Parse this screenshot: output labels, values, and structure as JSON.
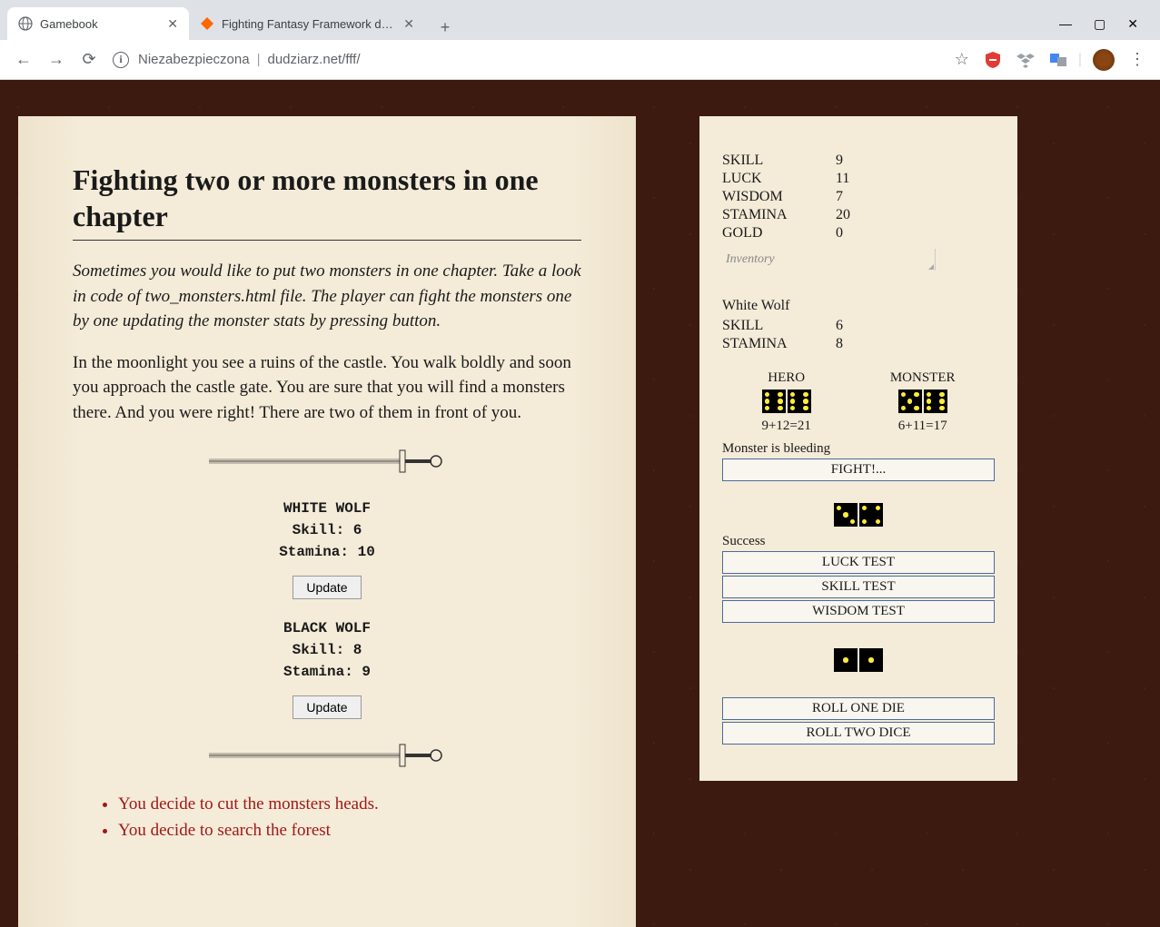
{
  "browser": {
    "tabs": [
      {
        "title": "Gamebook",
        "active": true
      },
      {
        "title": "Fighting Fantasy Framework dow...",
        "active": false
      }
    ],
    "window_controls": {
      "min": "—",
      "max": "▢",
      "close": "✕"
    },
    "address": {
      "security": "Niezabezpieczona",
      "url": "dudziarz.net/fff/"
    }
  },
  "page": {
    "title": "Fighting two or more monsters in one chapter",
    "intro": "Sometimes you would like to put two monsters in one chapter. Take a look in code of two_monsters.html file. The player can fight the monsters one by one updating the monster stats by pressing button.",
    "story": "In the moonlight you see a ruins of the castle. You walk boldly and soon you approach the castle gate. You are sure that you will find a monsters there. And you were right! There are two of them in front of you.",
    "monsters": [
      {
        "name": "WHITE WOLF",
        "skill_label": "Skill: 6",
        "stamina_label": "Stamina: 10",
        "button": "Update"
      },
      {
        "name": "BLACK WOLF",
        "skill_label": "Skill: 8",
        "stamina_label": "Stamina: 9",
        "button": "Update"
      }
    ],
    "choices": [
      "You decide to cut the monsters heads.",
      "You decide to search the forest"
    ]
  },
  "sidebar": {
    "hero_stats": {
      "skill": {
        "label": "SKILL",
        "value": "9"
      },
      "luck": {
        "label": "LUCK",
        "value": "11"
      },
      "wisdom": {
        "label": "WISDOM",
        "value": "7"
      },
      "stamina": {
        "label": "STAMINA",
        "value": "20"
      },
      "gold": {
        "label": "GOLD",
        "value": "0"
      }
    },
    "inventory_placeholder": "Inventory",
    "current_monster": {
      "name": "White Wolf",
      "skill": {
        "label": "SKILL",
        "value": "6"
      },
      "stamina": {
        "label": "STAMINA",
        "value": "8"
      }
    },
    "combat": {
      "hero_label": "HERO",
      "monster_label": "MONSTER",
      "hero_dice": [
        6,
        6
      ],
      "monster_dice": [
        5,
        6
      ],
      "hero_calc": "9+12=21",
      "monster_calc": "6+11=17",
      "status": "Monster is bleeding",
      "fight_button": "FIGHT!..."
    },
    "luck_section": {
      "dice": [
        3,
        4
      ],
      "status": "Success",
      "buttons": {
        "luck": "LUCK TEST",
        "skill": "SKILL TEST",
        "wisdom": "WISDOM TEST"
      }
    },
    "roll_section": {
      "dice": [
        1,
        1
      ],
      "buttons": {
        "one": "ROLL ONE DIE",
        "two": "ROLL TWO DICE"
      }
    }
  }
}
